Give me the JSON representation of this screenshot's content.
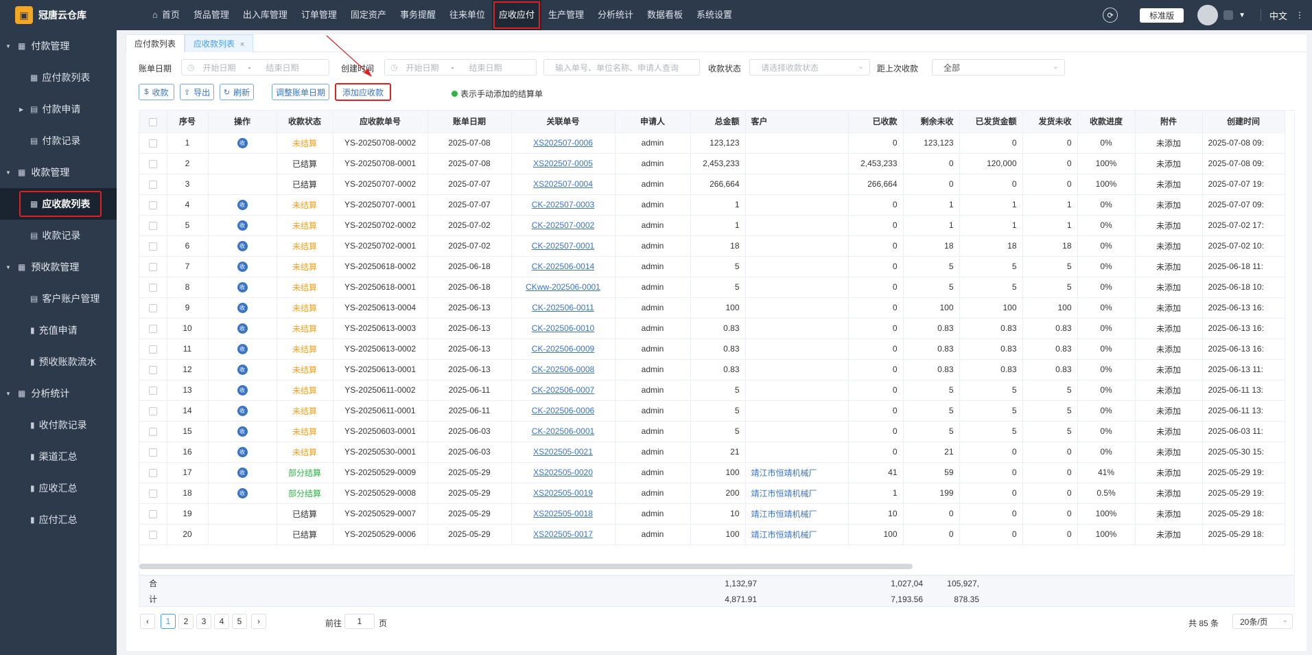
{
  "brand": {
    "name": "冠唐云仓库",
    "logo_icon": "warehouse-logo-icon"
  },
  "nav": [
    {
      "label": "首页",
      "icon": "home-icon"
    },
    {
      "label": "货品管理"
    },
    {
      "label": "出入库管理"
    },
    {
      "label": "订单管理"
    },
    {
      "label": "固定资产"
    },
    {
      "label": "事务提醒"
    },
    {
      "label": "往来单位"
    },
    {
      "label": "应收应付",
      "active": true
    },
    {
      "label": "生产管理"
    },
    {
      "label": "分析统计"
    },
    {
      "label": "数据看板"
    },
    {
      "label": "系统设置"
    }
  ],
  "topright": {
    "edition": "标准版",
    "lang": "中文"
  },
  "sidebar": [
    {
      "type": "group",
      "label": "付款管理"
    },
    {
      "type": "item",
      "label": "应付款列表"
    },
    {
      "type": "item",
      "label": "付款申请",
      "collapsed": true
    },
    {
      "type": "item",
      "label": "付款记录"
    },
    {
      "type": "group",
      "label": "收款管理"
    },
    {
      "type": "item",
      "label": "应收款列表",
      "active": true
    },
    {
      "type": "item",
      "label": "收款记录"
    },
    {
      "type": "group",
      "label": "预收款管理"
    },
    {
      "type": "item",
      "label": "客户账户管理"
    },
    {
      "type": "item",
      "label": "充值申请"
    },
    {
      "type": "item",
      "label": "预收账款流水"
    },
    {
      "type": "group",
      "label": "分析统计"
    },
    {
      "type": "item",
      "label": "收付款记录"
    },
    {
      "type": "item",
      "label": "渠道汇总"
    },
    {
      "type": "item",
      "label": "应收汇总"
    },
    {
      "type": "item",
      "label": "应付汇总"
    }
  ],
  "tabs": [
    {
      "label": "应付款列表"
    },
    {
      "label": "应收款列表",
      "active": true
    }
  ],
  "filters": {
    "bill_date_label": "账单日期",
    "create_time_label": "创建时间",
    "start_placeholder": "开始日期",
    "end_placeholder": "结束日期",
    "range_sep": "-",
    "search_placeholder": "输入单号、单位名称、申请人查询",
    "status_label": "收款状态",
    "status_placeholder": "请选择收款状态",
    "since_label": "距上次收款",
    "since_value": "全部"
  },
  "toolbar": {
    "collect": "收款",
    "export": "导出",
    "refresh": "刷新",
    "adjust_date": "调整账单日期",
    "add_receivable": "添加应收款",
    "legend_note": "表示手动添加的结算单"
  },
  "table": {
    "headers": [
      "序号",
      "操作",
      "收款状态",
      "应收款单号",
      "账单日期",
      "关联单号",
      "申请人",
      "总金额",
      "客户",
      "已收款",
      "剩余未收",
      "已发货金额",
      "发货未收",
      "收款进度",
      "附件",
      "创建时间"
    ],
    "op_icon_label": "收",
    "rows": [
      {
        "no": "1",
        "op": true,
        "status": "未结算",
        "st": "unsettled",
        "code": "YS-20250708-0002",
        "date": "2025-07-08",
        "ref": "XS202507-0006",
        "applicant": "admin",
        "total": "123,123",
        "customer": "",
        "received": "0",
        "remaining": "123,123",
        "shipped": "0",
        "ship_unrecv": "0",
        "progress": "0%",
        "attach": "未添加",
        "created": "2025-07-08 09:"
      },
      {
        "no": "2",
        "op": false,
        "status": "已结算",
        "st": "settled",
        "code": "YS-20250708-0001",
        "date": "2025-07-08",
        "ref": "XS202507-0005",
        "applicant": "admin",
        "total": "2,453,233",
        "customer": "",
        "received": "2,453,233",
        "remaining": "0",
        "shipped": "120,000",
        "ship_unrecv": "0",
        "progress": "100%",
        "attach": "未添加",
        "created": "2025-07-08 09:"
      },
      {
        "no": "3",
        "op": false,
        "status": "已结算",
        "st": "settled",
        "code": "YS-20250707-0002",
        "date": "2025-07-07",
        "ref": "XS202507-0004",
        "applicant": "admin",
        "total": "266,664",
        "customer": "",
        "received": "266,664",
        "remaining": "0",
        "shipped": "0",
        "ship_unrecv": "0",
        "progress": "100%",
        "attach": "未添加",
        "created": "2025-07-07 19:"
      },
      {
        "no": "4",
        "op": true,
        "status": "未结算",
        "st": "unsettled",
        "code": "YS-20250707-0001",
        "date": "2025-07-07",
        "ref": "CK-202507-0003",
        "applicant": "admin",
        "total": "1",
        "customer": "",
        "received": "0",
        "remaining": "1",
        "shipped": "1",
        "ship_unrecv": "1",
        "progress": "0%",
        "attach": "未添加",
        "created": "2025-07-07 09:"
      },
      {
        "no": "5",
        "op": true,
        "status": "未结算",
        "st": "unsettled",
        "code": "YS-20250702-0002",
        "date": "2025-07-02",
        "ref": "CK-202507-0002",
        "applicant": "admin",
        "total": "1",
        "customer": "",
        "received": "0",
        "remaining": "1",
        "shipped": "1",
        "ship_unrecv": "1",
        "progress": "0%",
        "attach": "未添加",
        "created": "2025-07-02 17:"
      },
      {
        "no": "6",
        "op": true,
        "status": "未结算",
        "st": "unsettled",
        "code": "YS-20250702-0001",
        "date": "2025-07-02",
        "ref": "CK-202507-0001",
        "applicant": "admin",
        "total": "18",
        "customer": "",
        "received": "0",
        "remaining": "18",
        "shipped": "18",
        "ship_unrecv": "18",
        "progress": "0%",
        "attach": "未添加",
        "created": "2025-07-02 10:"
      },
      {
        "no": "7",
        "op": true,
        "status": "未结算",
        "st": "unsettled",
        "code": "YS-20250618-0002",
        "date": "2025-06-18",
        "ref": "CK-202506-0014",
        "applicant": "admin",
        "total": "5",
        "customer": "",
        "received": "0",
        "remaining": "5",
        "shipped": "5",
        "ship_unrecv": "5",
        "progress": "0%",
        "attach": "未添加",
        "created": "2025-06-18 11:"
      },
      {
        "no": "8",
        "op": true,
        "status": "未结算",
        "st": "unsettled",
        "code": "YS-20250618-0001",
        "date": "2025-06-18",
        "ref": "CKww-202506-0001",
        "applicant": "admin",
        "total": "5",
        "customer": "",
        "received": "0",
        "remaining": "5",
        "shipped": "5",
        "ship_unrecv": "5",
        "progress": "0%",
        "attach": "未添加",
        "created": "2025-06-18 10:"
      },
      {
        "no": "9",
        "op": true,
        "status": "未结算",
        "st": "unsettled",
        "code": "YS-20250613-0004",
        "date": "2025-06-13",
        "ref": "CK-202506-0011",
        "applicant": "admin",
        "total": "100",
        "customer": "",
        "received": "0",
        "remaining": "100",
        "shipped": "100",
        "ship_unrecv": "100",
        "progress": "0%",
        "attach": "未添加",
        "created": "2025-06-13 16:"
      },
      {
        "no": "10",
        "op": true,
        "status": "未结算",
        "st": "unsettled",
        "code": "YS-20250613-0003",
        "date": "2025-06-13",
        "ref": "CK-202506-0010",
        "applicant": "admin",
        "total": "0.83",
        "customer": "",
        "received": "0",
        "remaining": "0.83",
        "shipped": "0.83",
        "ship_unrecv": "0.83",
        "progress": "0%",
        "attach": "未添加",
        "created": "2025-06-13 16:"
      },
      {
        "no": "11",
        "op": true,
        "status": "未结算",
        "st": "unsettled",
        "code": "YS-20250613-0002",
        "date": "2025-06-13",
        "ref": "CK-202506-0009",
        "applicant": "admin",
        "total": "0.83",
        "customer": "",
        "received": "0",
        "remaining": "0.83",
        "shipped": "0.83",
        "ship_unrecv": "0.83",
        "progress": "0%",
        "attach": "未添加",
        "created": "2025-06-13 16:"
      },
      {
        "no": "12",
        "op": true,
        "status": "未结算",
        "st": "unsettled",
        "code": "YS-20250613-0001",
        "date": "2025-06-13",
        "ref": "CK-202506-0008",
        "applicant": "admin",
        "total": "0.83",
        "customer": "",
        "received": "0",
        "remaining": "0.83",
        "shipped": "0.83",
        "ship_unrecv": "0.83",
        "progress": "0%",
        "attach": "未添加",
        "created": "2025-06-13 11:"
      },
      {
        "no": "13",
        "op": true,
        "status": "未结算",
        "st": "unsettled",
        "code": "YS-20250611-0002",
        "date": "2025-06-11",
        "ref": "CK-202506-0007",
        "applicant": "admin",
        "total": "5",
        "customer": "",
        "received": "0",
        "remaining": "5",
        "shipped": "5",
        "ship_unrecv": "5",
        "progress": "0%",
        "attach": "未添加",
        "created": "2025-06-11 13:"
      },
      {
        "no": "14",
        "op": true,
        "status": "未结算",
        "st": "unsettled",
        "code": "YS-20250611-0001",
        "date": "2025-06-11",
        "ref": "CK-202506-0006",
        "applicant": "admin",
        "total": "5",
        "customer": "",
        "received": "0",
        "remaining": "5",
        "shipped": "5",
        "ship_unrecv": "5",
        "progress": "0%",
        "attach": "未添加",
        "created": "2025-06-11 13:"
      },
      {
        "no": "15",
        "op": true,
        "status": "未结算",
        "st": "unsettled",
        "code": "YS-20250603-0001",
        "date": "2025-06-03",
        "ref": "CK-202506-0001",
        "applicant": "admin",
        "total": "5",
        "customer": "",
        "received": "0",
        "remaining": "5",
        "shipped": "5",
        "ship_unrecv": "5",
        "progress": "0%",
        "attach": "未添加",
        "created": "2025-06-03 11:"
      },
      {
        "no": "16",
        "op": true,
        "status": "未结算",
        "st": "unsettled",
        "code": "YS-20250530-0001",
        "date": "2025-06-03",
        "ref": "XS202505-0021",
        "applicant": "admin",
        "total": "21",
        "customer": "",
        "received": "0",
        "remaining": "21",
        "shipped": "0",
        "ship_unrecv": "0",
        "progress": "0%",
        "attach": "未添加",
        "created": "2025-05-30 15:"
      },
      {
        "no": "17",
        "op": true,
        "status": "部分结算",
        "st": "partial",
        "code": "YS-20250529-0009",
        "date": "2025-05-29",
        "ref": "XS202505-0020",
        "applicant": "admin",
        "total": "100",
        "customer": "靖江市恒靖机械厂",
        "received": "41",
        "remaining": "59",
        "shipped": "0",
        "ship_unrecv": "0",
        "progress": "41%",
        "attach": "未添加",
        "created": "2025-05-29 19:"
      },
      {
        "no": "18",
        "op": true,
        "status": "部分结算",
        "st": "partial",
        "code": "YS-20250529-0008",
        "date": "2025-05-29",
        "ref": "XS202505-0019",
        "applicant": "admin",
        "total": "200",
        "customer": "靖江市恒靖机械厂",
        "received": "1",
        "remaining": "199",
        "shipped": "0",
        "ship_unrecv": "0",
        "progress": "0.5%",
        "attach": "未添加",
        "created": "2025-05-29 19:"
      },
      {
        "no": "19",
        "op": false,
        "status": "已结算",
        "st": "settled",
        "code": "YS-20250529-0007",
        "date": "2025-05-29",
        "ref": "XS202505-0018",
        "applicant": "admin",
        "total": "10",
        "customer": "靖江市恒靖机械厂",
        "received": "10",
        "remaining": "0",
        "shipped": "0",
        "ship_unrecv": "0",
        "progress": "100%",
        "attach": "未添加",
        "created": "2025-05-29 18:"
      },
      {
        "no": "20",
        "op": false,
        "status": "已结算",
        "st": "settled",
        "code": "YS-20250529-0006",
        "date": "2025-05-29",
        "ref": "XS202505-0017",
        "applicant": "admin",
        "total": "100",
        "customer": "靖江市恒靖机械厂",
        "received": "100",
        "remaining": "0",
        "shipped": "0",
        "ship_unrecv": "0",
        "progress": "100%",
        "attach": "未添加",
        "created": "2025-05-29 18:"
      }
    ]
  },
  "summary": {
    "label_line1": "合",
    "label_line2": "计",
    "total_line1": "1,132,97",
    "total_line2": "4,871.91",
    "received_line1": "1,027,04",
    "received_line2": "7,193.56",
    "remaining_line1": "105,927,",
    "remaining_line2": "878.35"
  },
  "pager": {
    "pages": [
      "1",
      "2",
      "3",
      "4",
      "5"
    ],
    "current": "1",
    "goto_prefix": "前往",
    "goto_value": "1",
    "goto_suffix": "页",
    "total_text": "共 85 条",
    "page_size": "20条/页"
  },
  "colors": {
    "sidebar_bg": "#2d3a4b",
    "accent": "#409eff",
    "link": "#3a73c4",
    "unsettled": "#f0a020",
    "partial": "#2fb344",
    "highlight": "#e02020"
  }
}
